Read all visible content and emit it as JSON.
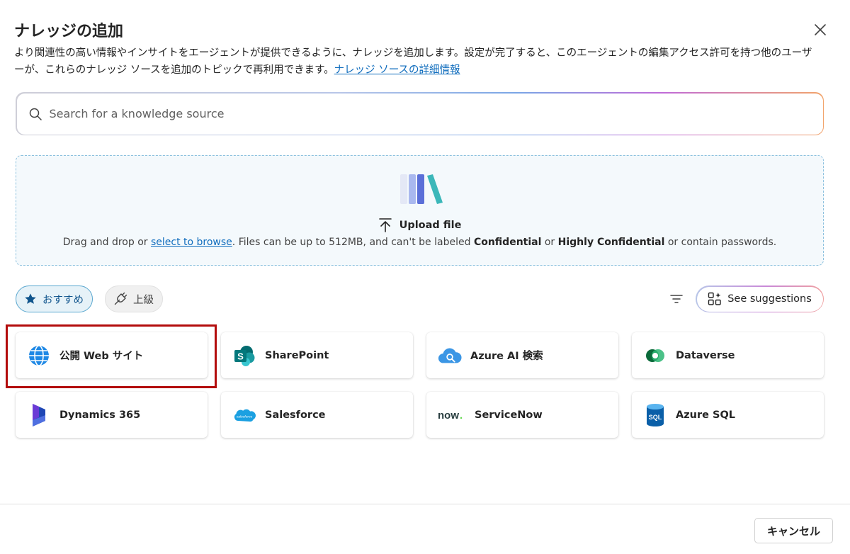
{
  "dialog": {
    "title": "ナレッジの追加",
    "description": "より関連性の高い情報やインサイトをエージェントが提供できるように、ナレッジを追加します。設定が完了すると、このエージェントの編集アクセス許可を持つ他のユーザーが、これらのナレッジ ソースを追加のトピックで再利用できます。",
    "details_link": "ナレッジ ソースの詳細情報"
  },
  "search": {
    "placeholder": "Search for a knowledge source"
  },
  "upload": {
    "title": "Upload file",
    "note_prefix": "Drag and drop or ",
    "browse_link": "select to browse",
    "note_mid": ". Files can be up to 512MB, and can't be labeled ",
    "confidential": "Confidential",
    "note_or": " or ",
    "highly_confidential": "Highly Confidential",
    "note_suffix": " or contain passwords."
  },
  "filters": {
    "recommended": "おすすめ",
    "advanced": "上級",
    "see_suggestions": "See suggestions"
  },
  "sources": [
    {
      "label": "公開 Web サイト",
      "icon": "globe-icon"
    },
    {
      "label": "SharePoint",
      "icon": "sharepoint-icon"
    },
    {
      "label": "Azure AI 検索",
      "icon": "azure-ai-search-icon"
    },
    {
      "label": "Dataverse",
      "icon": "dataverse-icon"
    },
    {
      "label": "Dynamics 365",
      "icon": "dynamics-365-icon"
    },
    {
      "label": "Salesforce",
      "icon": "salesforce-icon"
    },
    {
      "label": "ServiceNow",
      "icon": "servicenow-icon"
    },
    {
      "label": "Azure SQL",
      "icon": "azure-sql-icon"
    }
  ],
  "footer": {
    "cancel": "キャンセル"
  },
  "colors": {
    "link": "#0f6cbd",
    "highlight": "#b30c0c",
    "pill_active": "#e6f2f8"
  }
}
